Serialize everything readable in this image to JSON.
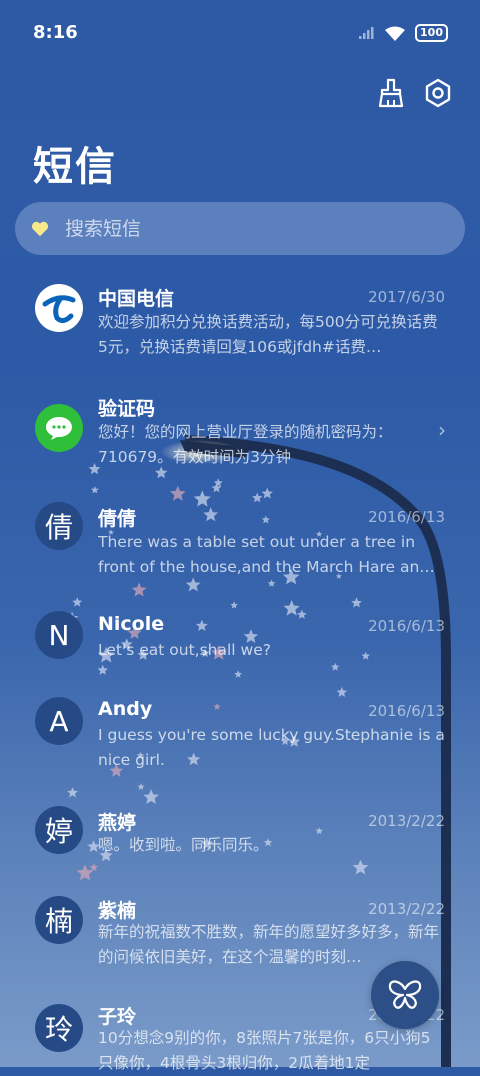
{
  "status_bar": {
    "time": "8:16",
    "battery": "100",
    "icons": [
      "signal-icon",
      "wifi-icon",
      "battery-icon"
    ]
  },
  "header": {
    "title": "短信",
    "actions": [
      "broom-icon",
      "settings-icon"
    ]
  },
  "search": {
    "placeholder": "搜索短信",
    "icon": "heart-icon"
  },
  "conversations": [
    {
      "name": "中国电信",
      "date": "2017/6/30",
      "message": "欢迎参加积分兑换话费活动，每500分可兑换话费5元，兑换话费请回复106或jfdh#话费…",
      "avatar": "china-telecom-logo"
    },
    {
      "name": "验证码",
      "date": "",
      "message": "您好！您的网上营业厅登录的随机密码为：710679。有效时间为3分钟",
      "avatar": "sms-bubble-logo",
      "chevron": "›"
    },
    {
      "name": "倩倩",
      "date": "2016/6/13",
      "message": "There was a table set out under a tree in front of the house,and the March Hare an…",
      "avatar": "倩"
    },
    {
      "name": "Nicole",
      "date": "2016/6/13",
      "message": "Let's eat out,shall we?",
      "avatar": "N"
    },
    {
      "name": "Andy",
      "date": "2016/6/13",
      "message": "I guess you're some lucky guy.Stephanie is a nice girl.",
      "avatar": "A"
    },
    {
      "name": "燕婷",
      "date": "2013/2/22",
      "message": "嗯。收到啦。同乐同乐。",
      "avatar": "婷"
    },
    {
      "name": "紫楠",
      "date": "2013/2/22",
      "message": "新年的祝福数不胜数，新年的愿望好多好多，新年的问候依旧美好，在这个温馨的时刻…",
      "avatar": "楠"
    },
    {
      "name": "子玲",
      "date": "2013/2/22",
      "message": "10分想念9别的你，8张照片7张是你，6只小狗5只像你，4根骨头3根归你，2瓜着地1定",
      "avatar": "玲"
    }
  ],
  "fab": {
    "icon": "butterfly-icon"
  },
  "colors": {
    "background": "#2d5aa6",
    "avatar": "#254a85",
    "heart": "#f7e88c"
  }
}
